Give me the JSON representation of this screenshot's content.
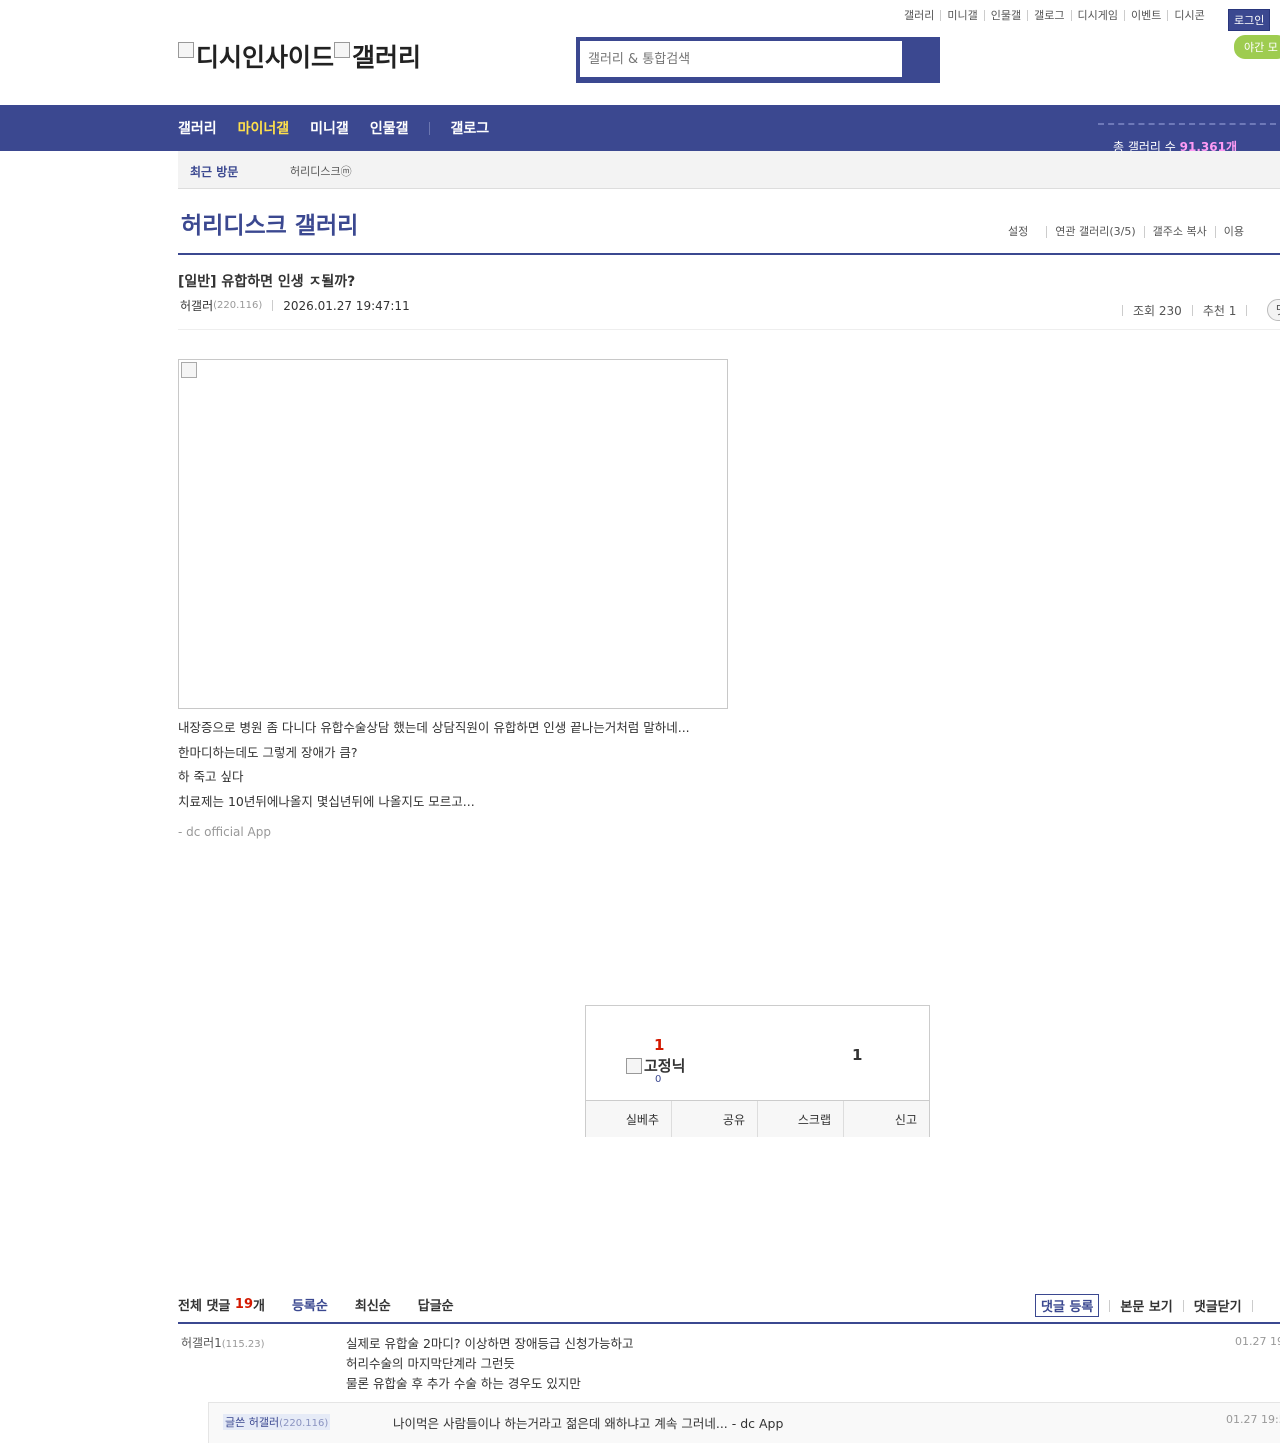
{
  "top_links": [
    "갤러리",
    "미니갤",
    "인물갤",
    "갤로그",
    "디시게임",
    "이벤트",
    "디시콘"
  ],
  "login_label": "로그인",
  "night_mode_label": "야간 모",
  "logo_alt": "디시인사이드",
  "logo_alt2": "갤러리",
  "search_placeholder": "갤러리 & 통합검색",
  "nav": {
    "items": [
      "갤러리",
      "마이너갤",
      "미니갤",
      "인물갤"
    ],
    "active": "마이너갤",
    "extra": "갤로그",
    "gallery_count_label": "총 갤러리 수",
    "gallery_count": "91,361개"
  },
  "recent": {
    "title": "최근 방문",
    "item": "허리디스크ⓜ"
  },
  "gallery": {
    "title": "허리디스크 갤러리",
    "options": [
      "설정",
      "연관 갤러리(3/5)",
      "갤주소 복사",
      "이용"
    ]
  },
  "post": {
    "title": "[일반] 유합하면 인생 ㅈ될까?",
    "author": "허갤러",
    "author_ip": "(220.116)",
    "datetime": "2026.01.27 19:47:11",
    "views": "조회 230",
    "recommends": "추천 1",
    "comment_btn": "댓",
    "body_lines": [
      "내장증으로 병원 좀 다니다 유합수술상담 했는데 상담직원이 유합하면 인생 끝나는거처럼 말하네...",
      "한마디하는데도 그렇게 장애가 큼?",
      "하 죽고 싶다",
      "치료제는 10년뒤에나올지 몇십년뒤에 나올지도 모르고..."
    ],
    "app_signature": "- dc official App"
  },
  "recommend_box": {
    "up_count": "1",
    "fixed_nick_label": "고정닉",
    "fixed_nick_count": "0",
    "down_count": "1",
    "buttons": [
      "실베추",
      "공유",
      "스크랩",
      "신고"
    ]
  },
  "comments_header": {
    "total_label": "전체 댓글",
    "total_count": "19",
    "total_suffix": "개",
    "sort_options": [
      "등록순",
      "최신순",
      "답글순"
    ],
    "active_sort": "등록순",
    "register": "댓글 등록",
    "view_body": "본문 보기",
    "close": "댓글닫기"
  },
  "comments": [
    {
      "nick": "허갤러1",
      "ip": "(115.23)",
      "lines": [
        "실제로 유합술 2마디? 이상하면 장애등급 신청가능하고",
        "허리수술의 마지막단계라 그런듯",
        "물론 유합술 후 추가 수술 하는 경우도 있지만"
      ],
      "date": "01.27 19"
    }
  ],
  "reply": {
    "prefix": "글쓴",
    "nick": "허갤러",
    "ip": "(220.116)",
    "text": "나이먹은 사람들이나 하는거라고 젊은데 왜하냐고 계속 그러네... - dc App",
    "date": "01.27 19:5"
  },
  "colors": {
    "brand": "#3b4890",
    "active_nav": "#ffe04b",
    "count_red": "#d31900",
    "night_btn": "#9ecc50"
  }
}
